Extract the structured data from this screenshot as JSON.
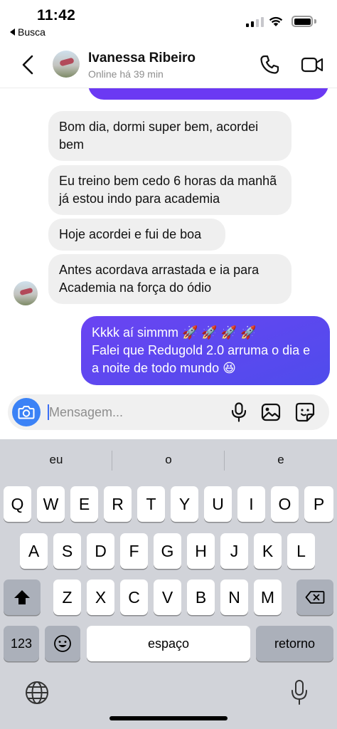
{
  "status_bar": {
    "time": "11:42",
    "back_app": "Busca"
  },
  "header": {
    "contact_name": "Ivanessa Ribeiro",
    "presence": "Online há 39 min",
    "icons": [
      "chevron-left-icon",
      "phone-icon",
      "video-camera-icon"
    ]
  },
  "messages": [
    {
      "direction": "in",
      "text": "Bom dia, dormi super bem, acordei bem"
    },
    {
      "direction": "in",
      "text": "Eu treino bem cedo 6 horas da manhã já estou indo para academia"
    },
    {
      "direction": "in",
      "text": "Hoje acordei e fui de boa"
    },
    {
      "direction": "in",
      "text": "Antes acordava arrastada e ia para Academia na força do ódio"
    },
    {
      "direction": "out",
      "line1": "Kkkk aí simmm 🚀 🚀 🚀 🚀",
      "line2": "Falei que Redugold 2.0 arruma o dia e a noite de todo mundo 😆"
    }
  ],
  "composer": {
    "placeholder": "Mensagem...",
    "value": "",
    "icons": [
      "camera-icon",
      "microphone-icon",
      "image-icon",
      "sticker-icon"
    ]
  },
  "keyboard": {
    "suggestions": [
      "eu",
      "o",
      "e"
    ],
    "row1": [
      "Q",
      "W",
      "E",
      "R",
      "T",
      "Y",
      "U",
      "I",
      "O",
      "P"
    ],
    "row2": [
      "A",
      "S",
      "D",
      "F",
      "G",
      "H",
      "J",
      "K",
      "L"
    ],
    "row3": [
      "Z",
      "X",
      "C",
      "V",
      "B",
      "N",
      "M"
    ],
    "numbers_key": "123",
    "space_key": "espaço",
    "return_key": "retorno"
  },
  "colors": {
    "outgoing_bubble": "#5a46f0",
    "incoming_bubble": "#efefef",
    "camera_button": "#3b82f6",
    "keyboard_bg": "#d1d3d9"
  }
}
